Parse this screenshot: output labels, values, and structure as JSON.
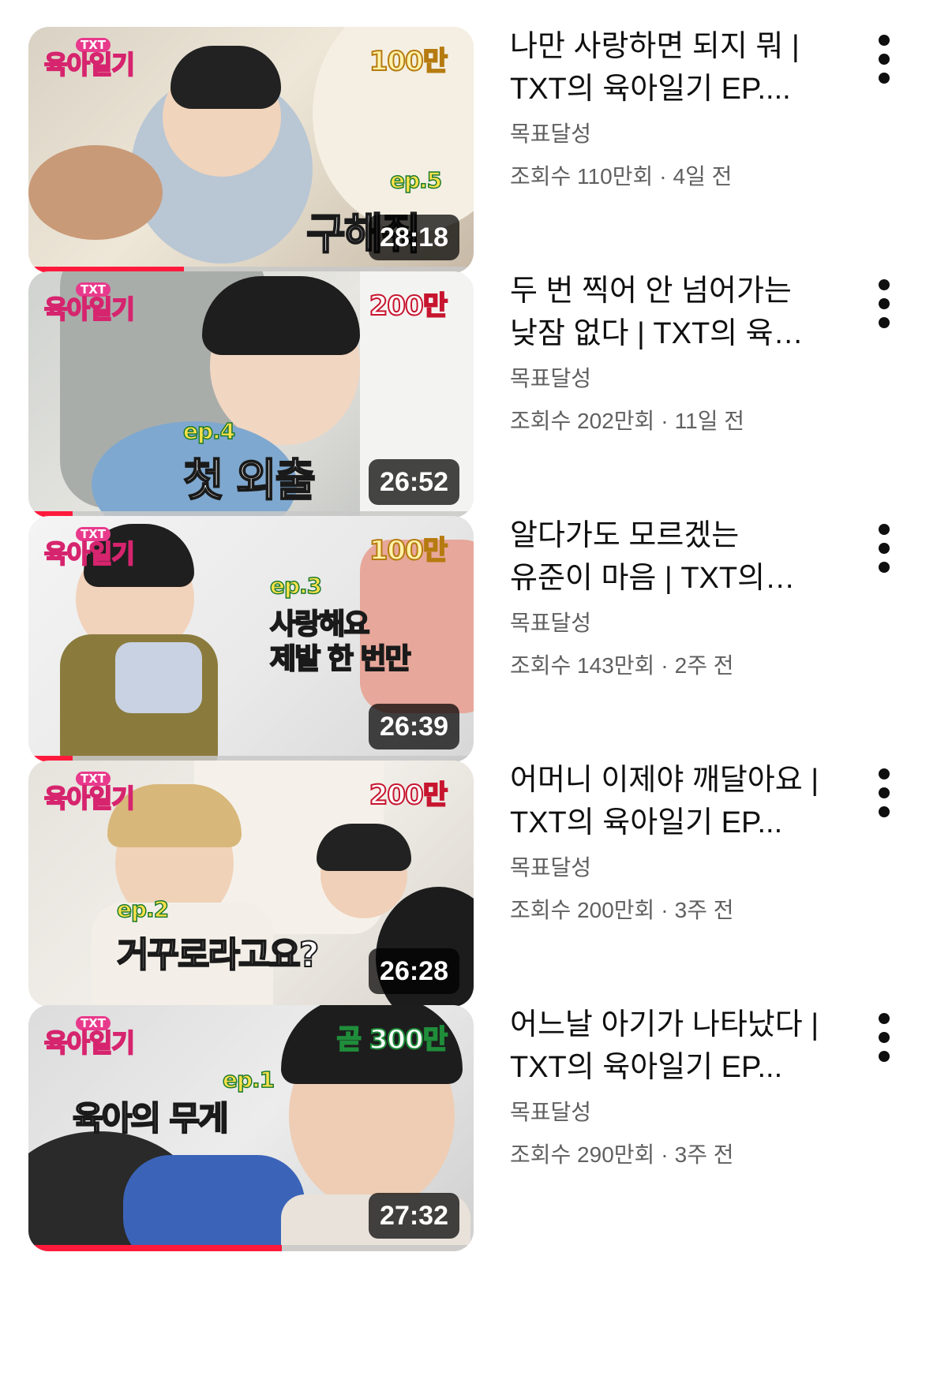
{
  "videos": [
    {
      "title": "나만 사랑하면 되지 뭐 | TXT의 육아일기 EP....",
      "channel": "목표달성",
      "views": "조회수 110만회",
      "age": "4일 전",
      "duration": "28:18",
      "progress": 0.35,
      "thumb": {
        "logo_sup": "TXT",
        "logo": "육아일기",
        "badge": "100만",
        "ep": "ep.5",
        "caption": "구해줘"
      }
    },
    {
      "title": "두 번 찍어 안 넘어가는 낮잠 없다 | TXT의 육…",
      "channel": "목표달성",
      "views": "조회수 202만회",
      "age": "11일 전",
      "duration": "26:52",
      "progress": 0.1,
      "thumb": {
        "logo_sup": "TXT",
        "logo": "육아일기",
        "badge": "200만",
        "ep": "ep.4",
        "caption": "첫 외출"
      }
    },
    {
      "title": "알다가도 모르겠는 유준이 마음 | TXT의 육아…",
      "channel": "목표달성",
      "views": "조회수 143만회",
      "age": "2주 전",
      "duration": "26:39",
      "progress": 0.1,
      "thumb": {
        "logo_sup": "TXT",
        "logo": "육아일기",
        "badge": "100만",
        "ep": "ep.3",
        "caption": "사랑해요",
        "caption2": "제발 한 번만"
      }
    },
    {
      "title": "어머니 이제야 깨달아요 | TXT의 육아일기 EP...",
      "channel": "목표달성",
      "views": "조회수 200만회",
      "age": "3주 전",
      "duration": "26:28",
      "progress": 0,
      "thumb": {
        "logo_sup": "TXT",
        "logo": "육아일기",
        "badge": "200만",
        "ep": "ep.2",
        "caption": "거꾸로라고요?"
      }
    },
    {
      "title": "어느날 아기가 나타났다 | TXT의 육아일기 EP...",
      "channel": "목표달성",
      "views": "조회수 290만회",
      "age": "3주 전",
      "duration": "27:32",
      "progress": 0.57,
      "thumb": {
        "logo_sup": "TXT",
        "logo": "육아일기",
        "badge": "곧 300만",
        "ep": "ep.1",
        "caption": "육아의 무게"
      }
    }
  ],
  "icons": {
    "more": "vertical-ellipsis-icon"
  },
  "colors": {
    "progress": "#ff1a3c",
    "secondary_text": "#606060"
  }
}
